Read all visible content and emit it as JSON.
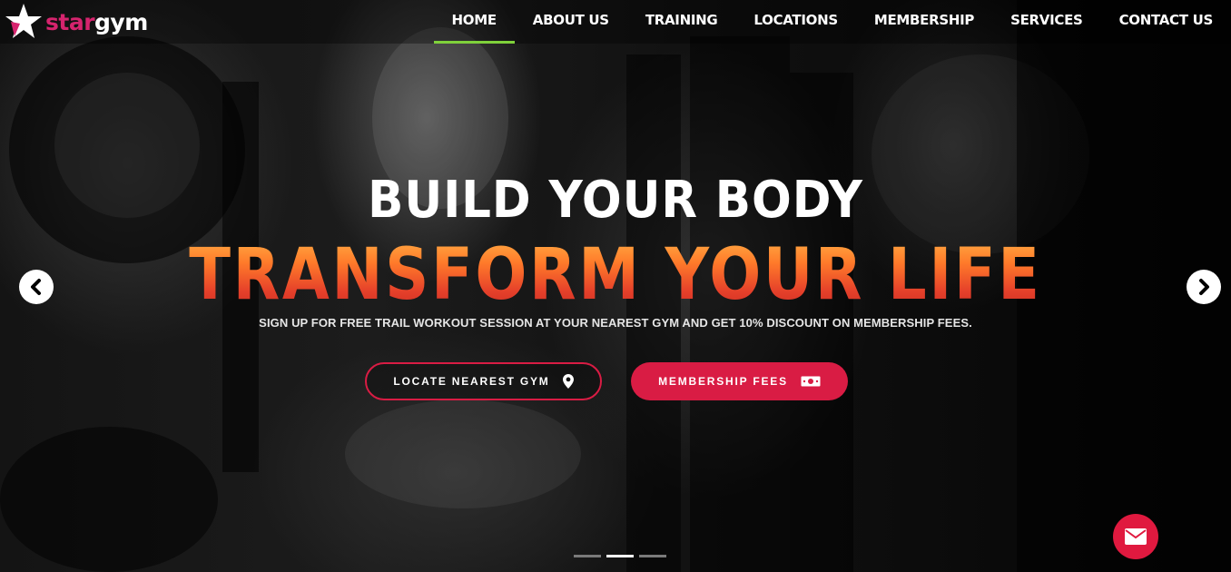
{
  "brand": {
    "logo_part1": "star",
    "logo_part2": "gym",
    "logo_icon": "star-icon",
    "accent": "#d6246e"
  },
  "nav": {
    "active_underline_color": "#7fd13b",
    "items": [
      {
        "label": "HOME",
        "active": true
      },
      {
        "label": "ABOUT US"
      },
      {
        "label": "TRAINING"
      },
      {
        "label": "LOCATIONS"
      },
      {
        "label": "MEMBERSHIP"
      },
      {
        "label": "SERVICES"
      },
      {
        "label": "CONTACT US"
      }
    ]
  },
  "hero": {
    "headline": "BUILD YOUR BODY",
    "subheadline": "TRANSFORM YOUR LIFE",
    "description": "SIGN UP FOR FREE TRAIL WORKOUT SESSION AT YOUR NEAREST GYM AND GET 10% DISCOUNT ON MEMBERSHIP FEES.",
    "buttons": {
      "locate": {
        "label": "LOCATE NEAREST GYM",
        "icon": "map-marker-icon"
      },
      "fees": {
        "label": "MEMBERSHIP FEES",
        "icon": "money-bill-icon"
      }
    },
    "primary_color": "#d91c44"
  },
  "carousel": {
    "prev_icon": "chevron-left-icon",
    "next_icon": "chevron-right-icon",
    "slides": 3,
    "active_slide": 2
  },
  "contact_fab": {
    "icon": "envelope-icon",
    "color": "#e0193f"
  }
}
